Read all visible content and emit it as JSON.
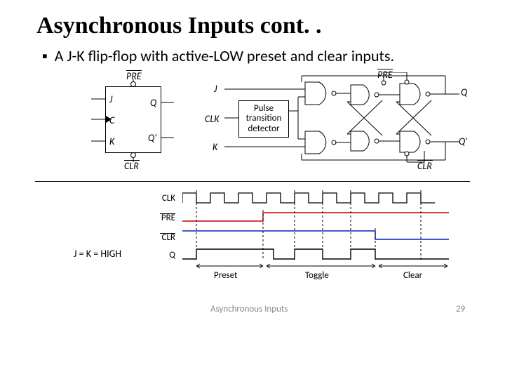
{
  "title": "Asynchronous Inputs cont. .",
  "bullet_text": "A J-K flip-flop with active-LOW preset and clear inputs.",
  "ff_symbol": {
    "pre": "PRE",
    "j": "J",
    "c": "C",
    "k": "K",
    "q": "Q",
    "qbar": "Q'",
    "clr": "CLR"
  },
  "internal": {
    "pre": "PRE",
    "j": "J",
    "clk": "CLK",
    "k": "K",
    "q": "Q",
    "qbar": "Q'",
    "clr": "CLR",
    "ptd_l1": "Pulse",
    "ptd_l2": "transition",
    "ptd_l3": "detector"
  },
  "waves": {
    "clk": "CLK",
    "pre": "PRE",
    "clr": "CLR",
    "q": "Q",
    "jk_high": "J = K = HIGH",
    "preset": "Preset",
    "toggle": "Toggle",
    "clear": "Clear"
  },
  "footer": {
    "text": "Asynchronous Inputs",
    "page": "29"
  },
  "chart_data": {
    "type": "timing-diagram",
    "signals": [
      {
        "name": "CLK",
        "pattern": "periodic square wave, 9 pulses"
      },
      {
        "name": "PRE",
        "active": "LOW",
        "transitions": [
          "low segment early",
          "then high for remainder"
        ]
      },
      {
        "name": "CLR",
        "active": "LOW",
        "transitions": [
          "high",
          "low segment late",
          "pulses low at end"
        ]
      },
      {
        "name": "Q",
        "segments": [
          {
            "label": "Preset",
            "level": "HIGH (forced)"
          },
          {
            "label": "Toggle",
            "level": "toggling with CLK"
          },
          {
            "label": "Clear",
            "level": "LOW (forced)"
          }
        ]
      }
    ],
    "condition": "J = K = HIGH"
  }
}
